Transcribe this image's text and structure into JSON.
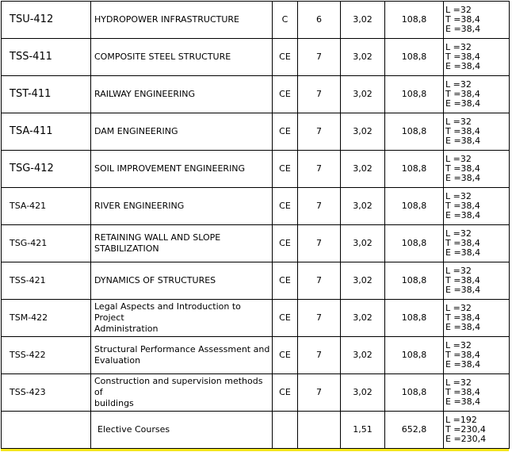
{
  "rows": [
    {
      "code": "TSU-412",
      "name": [
        "HYDROPOWER INFRASTRUCTURE"
      ],
      "type": "C",
      "sem": "6",
      "credit": "3,02",
      "total": "108,8",
      "hours": [
        "L =32",
        "T =38,4",
        "E =38,4"
      ],
      "code_size": "big"
    },
    {
      "code": "TSS-411",
      "name": [
        "COMPOSITE STEEL STRUCTURE"
      ],
      "type": "CE",
      "sem": "7",
      "credit": "3,02",
      "total": "108,8",
      "hours": [
        "L =32",
        "T =38,4",
        "E =38,4"
      ],
      "code_size": "big"
    },
    {
      "code": "TST-411",
      "name": [
        "RAILWAY ENGINEERING"
      ],
      "type": "CE",
      "sem": "7",
      "credit": "3,02",
      "total": "108,8",
      "hours": [
        "L =32",
        "T =38,4",
        "E =38,4"
      ],
      "code_size": "big"
    },
    {
      "code": "TSA-411",
      "name": [
        "DAM ENGINEERING"
      ],
      "type": "CE",
      "sem": "7",
      "credit": "3,02",
      "total": "108,8",
      "hours": [
        "L =32",
        "T =38,4",
        "E =38,4"
      ],
      "code_size": "big"
    },
    {
      "code": "TSG-412",
      "name": [
        "SOIL IMPROVEMENT ENGINEERING"
      ],
      "type": "CE",
      "sem": "7",
      "credit": "3,02",
      "total": "108,8",
      "hours": [
        "L =32",
        "T =38,4",
        "E =38,4"
      ],
      "code_size": "big"
    },
    {
      "code": "TSA-421",
      "name": [
        "RIVER ENGINEERING"
      ],
      "type": "CE",
      "sem": "7",
      "credit": "3,02",
      "total": "108,8",
      "hours": [
        "L =32",
        "T =38,4",
        "E =38,4"
      ],
      "code_size": "small"
    },
    {
      "code": "TSG-421",
      "name": [
        "RETAINING WALL AND SLOPE",
        "STABILIZATION"
      ],
      "type": "CE",
      "sem": "7",
      "credit": "3,02",
      "total": "108,8",
      "hours": [
        "L =32",
        "T =38,4",
        "E =38,4"
      ],
      "code_size": "small"
    },
    {
      "code": "TSS-421",
      "name": [
        "DYNAMICS OF STRUCTURES"
      ],
      "type": "CE",
      "sem": "7",
      "credit": "3,02",
      "total": "108,8",
      "hours": [
        "L =32",
        "T =38,4",
        "E =38,4"
      ],
      "code_size": "small"
    },
    {
      "code": "TSM-422",
      "name": [
        "Legal Aspects and Introduction to Project",
        "Administration"
      ],
      "type": "CE",
      "sem": "7",
      "credit": "3,02",
      "total": "108,8",
      "hours": [
        "L =32",
        "T =38,4",
        "E =38,4"
      ],
      "code_size": "small"
    },
    {
      "code": "TSS-422",
      "name": [
        "Structural Performance Assessment and",
        "Evaluation"
      ],
      "type": "CE",
      "sem": "7",
      "credit": "3,02",
      "total": "108,8",
      "hours": [
        "L =32",
        "T =38,4",
        "E =38,4"
      ],
      "code_size": "small"
    },
    {
      "code": "TSS-423",
      "name": [
        "Construction and supervision methods of",
        "buildings"
      ],
      "type": "CE",
      "sem": "7",
      "credit": "3,02",
      "total": "108,8",
      "hours": [
        "L =32",
        "T =38,4",
        "E =38,4"
      ],
      "code_size": "small"
    }
  ],
  "elective": {
    "code": "",
    "name": "Elective Courses",
    "type": "",
    "sem": "",
    "credit": "1,51",
    "total": "652,8",
    "hours": [
      "L =192",
      "T =230,4",
      "E =230,4"
    ]
  },
  "colors": {
    "border": "#000000",
    "bottom_stripe": "#f5e71a"
  }
}
